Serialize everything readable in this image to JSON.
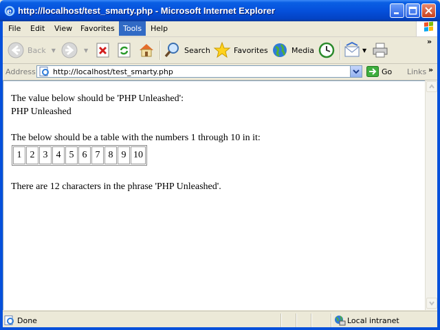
{
  "window": {
    "title": "http://localhost/test_smarty.php - Microsoft Internet Explorer"
  },
  "menu": [
    "File",
    "Edit",
    "View",
    "Favorites",
    "Tools",
    "Help"
  ],
  "toolbar": {
    "back": "Back",
    "search": "Search",
    "favorites": "Favorites",
    "media": "Media"
  },
  "address": {
    "label": "Address",
    "url": "http://localhost/test_smarty.php",
    "go": "Go",
    "links": "Links"
  },
  "page": {
    "line1": "The value below should be 'PHP Unleashed':",
    "line2": "PHP Unleashed",
    "line3": "The below should be a table with the numbers 1 through 10 in it:",
    "numbers": [
      "1",
      "2",
      "3",
      "4",
      "5",
      "6",
      "7",
      "8",
      "9",
      "10"
    ],
    "line4": "There are 12 characters in the phrase 'PHP Unleashed'."
  },
  "status": {
    "text": "Done",
    "zone": "Local intranet"
  }
}
